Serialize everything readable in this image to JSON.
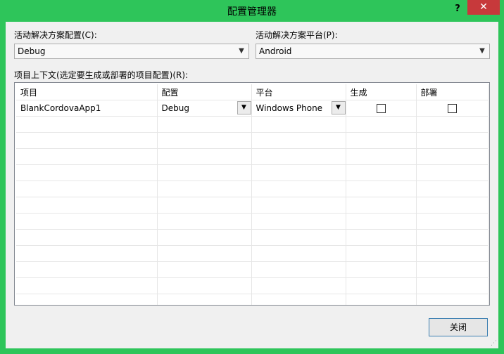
{
  "window": {
    "title": "配置管理器",
    "help": "?",
    "close": "✕"
  },
  "solution": {
    "config_label": "活动解决方案配置(C):",
    "config_value": "Debug",
    "platform_label": "活动解决方案平台(P):",
    "platform_value": "Android"
  },
  "grid": {
    "label": "项目上下文(选定要生成或部署的项目配置)(R):",
    "columns": [
      "项目",
      "配置",
      "平台",
      "生成",
      "部署"
    ],
    "rows": [
      {
        "project": "BlankCordovaApp1",
        "config": "Debug",
        "platform": "Windows Phone",
        "build": false,
        "deploy": false
      }
    ]
  },
  "footer": {
    "close_button": "关闭"
  },
  "icons": {
    "dropdown": "chevron-down-icon",
    "grip": "resize-grip-icon"
  },
  "colors": {
    "frame": "#2ec55a",
    "close": "#c7393b",
    "client": "#f0f0f0"
  }
}
